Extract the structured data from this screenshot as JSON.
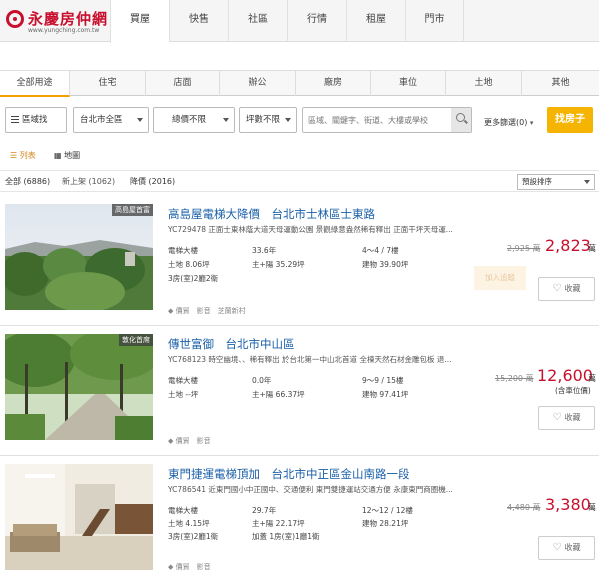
{
  "header": {
    "logo_text": "永慶房仲網",
    "logo_url": "www.yungching.com.tw",
    "tabs": [
      "買屋",
      "快售",
      "社區",
      "行情",
      "租屋",
      "門市"
    ],
    "active_tab": 0
  },
  "categories": {
    "items": [
      "全部用途",
      "住宅",
      "店面",
      "辦公",
      "廠房",
      "車位",
      "土地",
      "其他"
    ],
    "active": 0
  },
  "filters": {
    "area_btn": "區域找",
    "city": "台北市全區",
    "price": "總價不限",
    "size": "坪數不限",
    "search_placeholder": "區域、關鍵字、街道、大樓或學校",
    "more": "更多篩選(0)",
    "find_button": "找房子"
  },
  "view": {
    "list_label": "列表",
    "map_label": "地圖"
  },
  "counts": {
    "all": "全部 (6886)",
    "new": "新上架 (1062)",
    "reduced": "降價 (2016)",
    "sort": "預設排序"
  },
  "listings": [
    {
      "badge": "高島屋首富",
      "title": "高島屋電梯大降價　台北市士林區士東路",
      "desc": "YC729478 正面士東林蔭大道天母運動公園 景觀綠意盎然稀有釋出 正面干坪天母運...",
      "type": "電梯大樓",
      "age": "33.6年",
      "floor": "4～4 / 7樓",
      "land": "土地 8.06坪",
      "main": "主+陽 35.29坪",
      "building": "建物 39.90坪",
      "rooms": "3房(室)2廳2衛",
      "old_price": "2,925 萬",
      "price": "2,823",
      "unit": "萬",
      "note": "",
      "watch": "加入追蹤",
      "tags": "價貿　影音　芝蘭新村",
      "fav": "收藏"
    },
    {
      "badge": "敦化首席",
      "title": "傳世富御　台北市中山區",
      "desc": "YC768123 時空幽境、、稀有釋出 於台北第一中山北首道 全棟天然石材金雕包板 退...",
      "type": "電梯大樓",
      "age": "0.0年",
      "floor": "9～9 / 15樓",
      "land": "土地 --坪",
      "main": "主+陽 66.37坪",
      "building": "建物 97.41坪",
      "rooms": "",
      "old_price": "15,200 萬",
      "price": "12,600",
      "unit": "萬",
      "note": "(含車位價)",
      "watch": "",
      "tags": "價貿　影音",
      "fav": "收藏"
    },
    {
      "badge": "",
      "title": "東門捷運電梯頂加　台北市中正區金山南路一段",
      "desc": "YC786541 近東門國小中正國中、交通便利 東門雙捷運站交通方便 永康東門商圈機...",
      "type": "電梯大樓",
      "age": "29.7年",
      "floor": "12～12 / 12樓",
      "land": "土地 4.15坪",
      "main": "主+陽 22.17坪",
      "building": "建物 28.21坪",
      "rooms": "3房(室)2廳1衛",
      "extra": "加蓋 1房(室)1廳1衛",
      "old_price": "4,480 萬",
      "price": "3,380",
      "unit": "萬",
      "note": "",
      "watch": "",
      "tags": "價貿　影音",
      "fav": "收藏"
    }
  ]
}
